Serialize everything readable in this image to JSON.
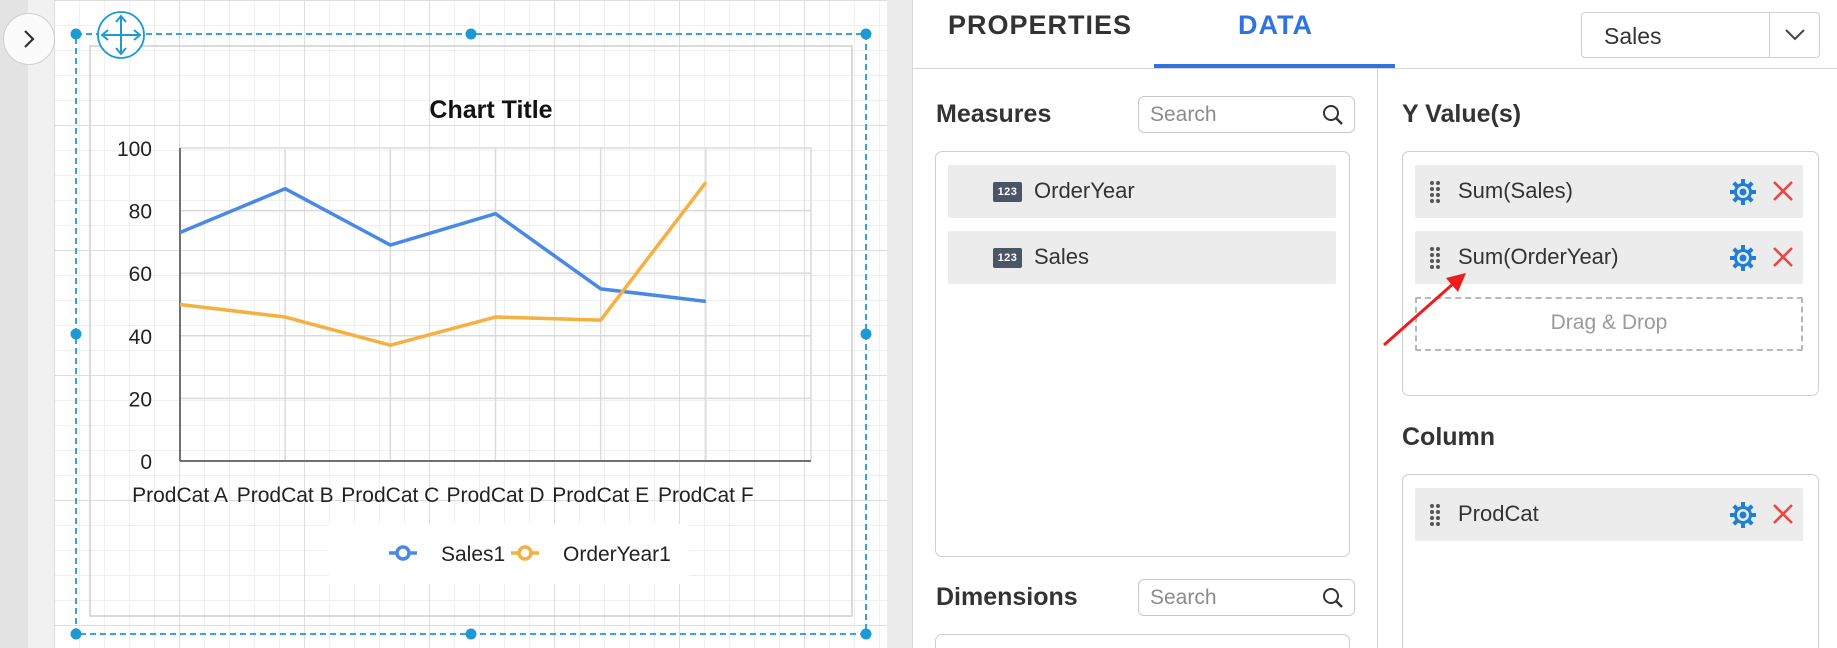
{
  "designer": {
    "collapse_icon": "chevron-right-icon",
    "move_icon": "move-arrows-icon"
  },
  "chart_data": {
    "type": "line",
    "title": "Chart Title",
    "categories": [
      "ProdCat A",
      "ProdCat B",
      "ProdCat C",
      "ProdCat D",
      "ProdCat E",
      "ProdCat F"
    ],
    "series": [
      {
        "name": "Sales1",
        "values": [
          73,
          87,
          69,
          79,
          55,
          51
        ],
        "color": "#4a88e6"
      },
      {
        "name": "OrderYear1",
        "values": [
          50,
          46,
          37,
          46,
          45,
          89
        ],
        "color": "#f5b041"
      }
    ],
    "ylim": [
      0,
      100
    ],
    "yticks": [
      "0",
      "20",
      "40",
      "60",
      "80",
      "100"
    ],
    "grid": true,
    "legend_position": "bottom"
  },
  "panel": {
    "tabs": [
      {
        "label": "PROPERTIES",
        "active": false
      },
      {
        "label": "DATA",
        "active": true
      }
    ],
    "dataset": {
      "value": "Sales",
      "icon": "chevron-down-icon"
    },
    "measures": {
      "title": "Measures",
      "search_placeholder": "Search",
      "items": [
        {
          "label": "OrderYear",
          "badge": "123"
        },
        {
          "label": "Sales",
          "badge": "123"
        }
      ]
    },
    "dimensions": {
      "title": "Dimensions",
      "search_placeholder": "Search"
    },
    "y_values": {
      "title": "Y Value(s)",
      "items": [
        {
          "label": "Sum(Sales)"
        },
        {
          "label": "Sum(OrderYear)"
        }
      ],
      "drop_text": "Drag & Drop"
    },
    "column": {
      "title": "Column",
      "items": [
        {
          "label": "ProdCat"
        }
      ]
    }
  },
  "colors": {
    "accent": "#2f73e0",
    "gear": "#1f7fd6",
    "remove": "#e84848",
    "arrow_annotation": "#ee1c1c"
  }
}
